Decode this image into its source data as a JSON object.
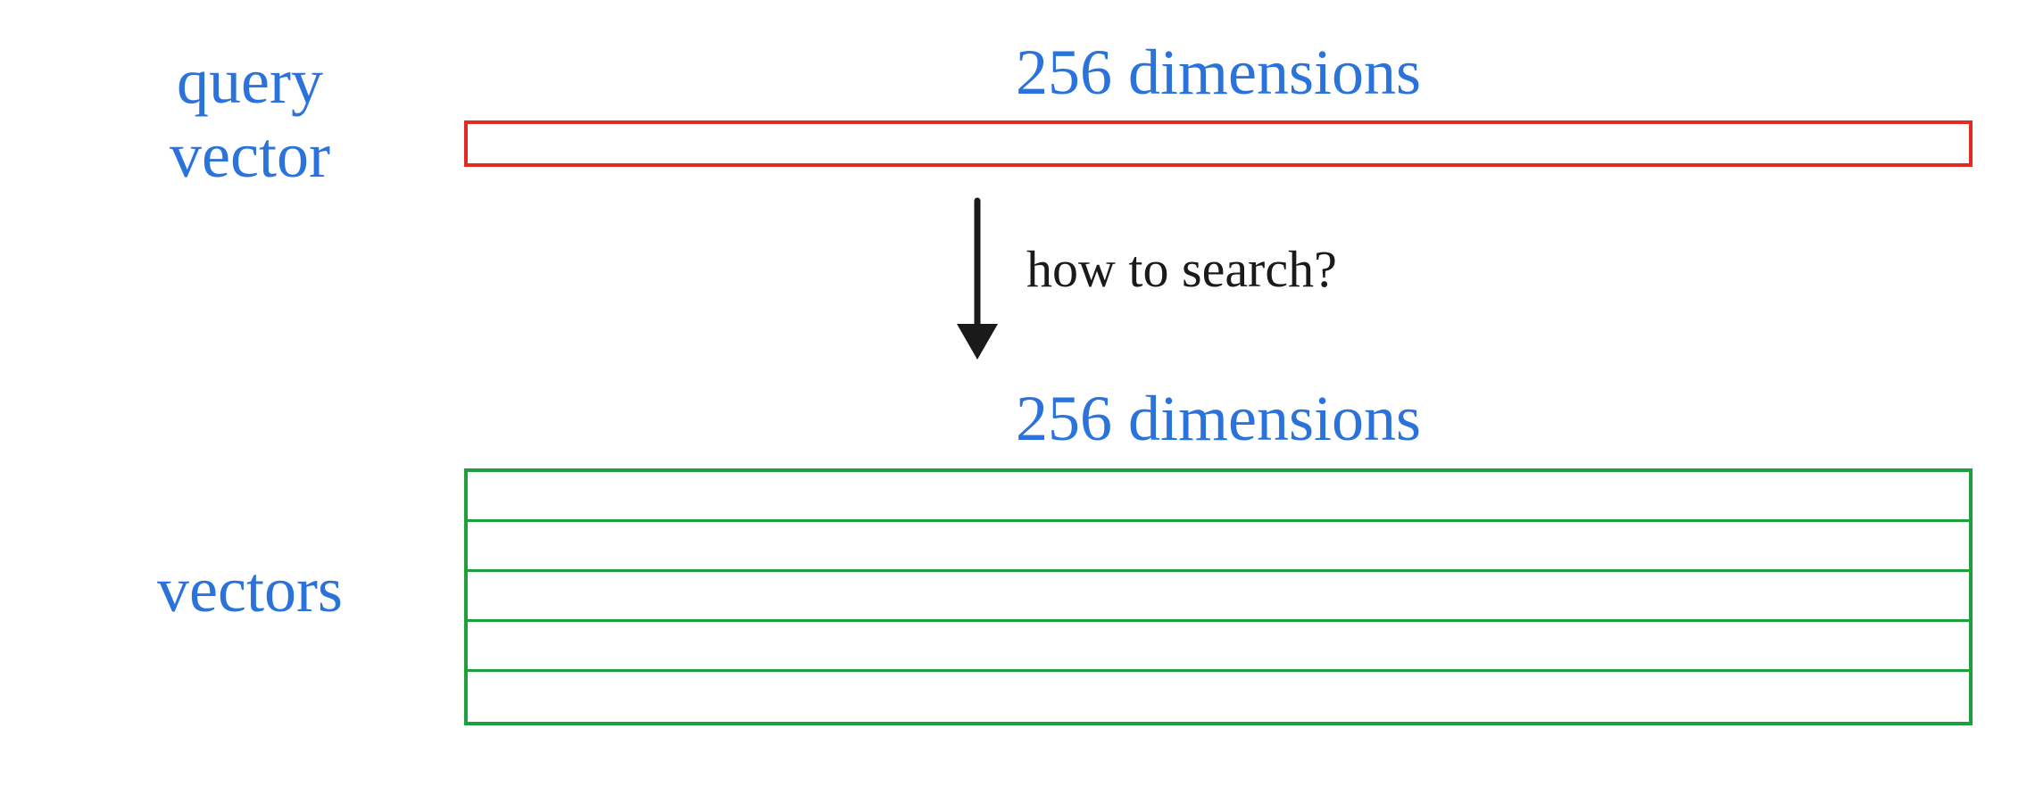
{
  "query": {
    "label": "query\nvector",
    "dim_label": "256 dimensions",
    "dimensions": 256,
    "box_color": "#e22b22"
  },
  "arrow": {
    "label": "how to search?"
  },
  "vectors": {
    "label": "vectors",
    "dim_label": "256 dimensions",
    "dimensions": 256,
    "row_count": 5,
    "box_color": "#1d9f3e"
  },
  "colors": {
    "text_blue": "#2b73db",
    "text_black": "#1a1a1a"
  }
}
